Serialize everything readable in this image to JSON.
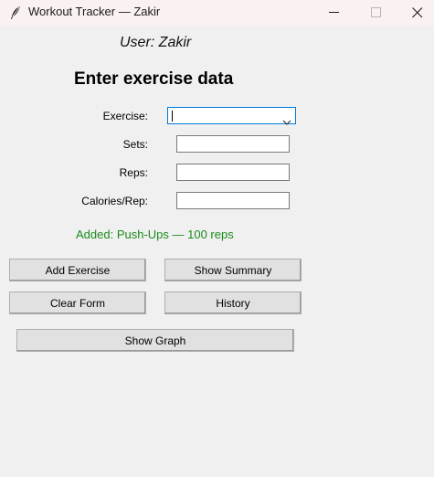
{
  "window": {
    "title": "Workout Tracker — Zakir"
  },
  "user_label": "User: Zakir",
  "heading": "Enter exercise data",
  "form": {
    "exercise_label": "Exercise:",
    "exercise_value": "",
    "sets_label": "Sets:",
    "sets_value": "",
    "reps_label": "Reps:",
    "reps_value": "",
    "calories_label": "Calories/Rep:",
    "calories_value": ""
  },
  "status_message": "Added: Push-Ups — 100 reps",
  "buttons": {
    "add_exercise": "Add Exercise",
    "show_summary": "Show Summary",
    "clear_form": "Clear Form",
    "history": "History",
    "show_graph": "Show Graph"
  },
  "colors": {
    "status_green": "#1a8a1a",
    "focus_blue": "#0078d7",
    "window_bg": "#f0f0f0",
    "titlebar_bg": "#faf2f2"
  },
  "icons": {
    "app": "feather-icon",
    "minimize": "minimize-icon",
    "maximize": "maximize-icon",
    "close": "close-icon",
    "dropdown": "chevron-down-icon"
  }
}
